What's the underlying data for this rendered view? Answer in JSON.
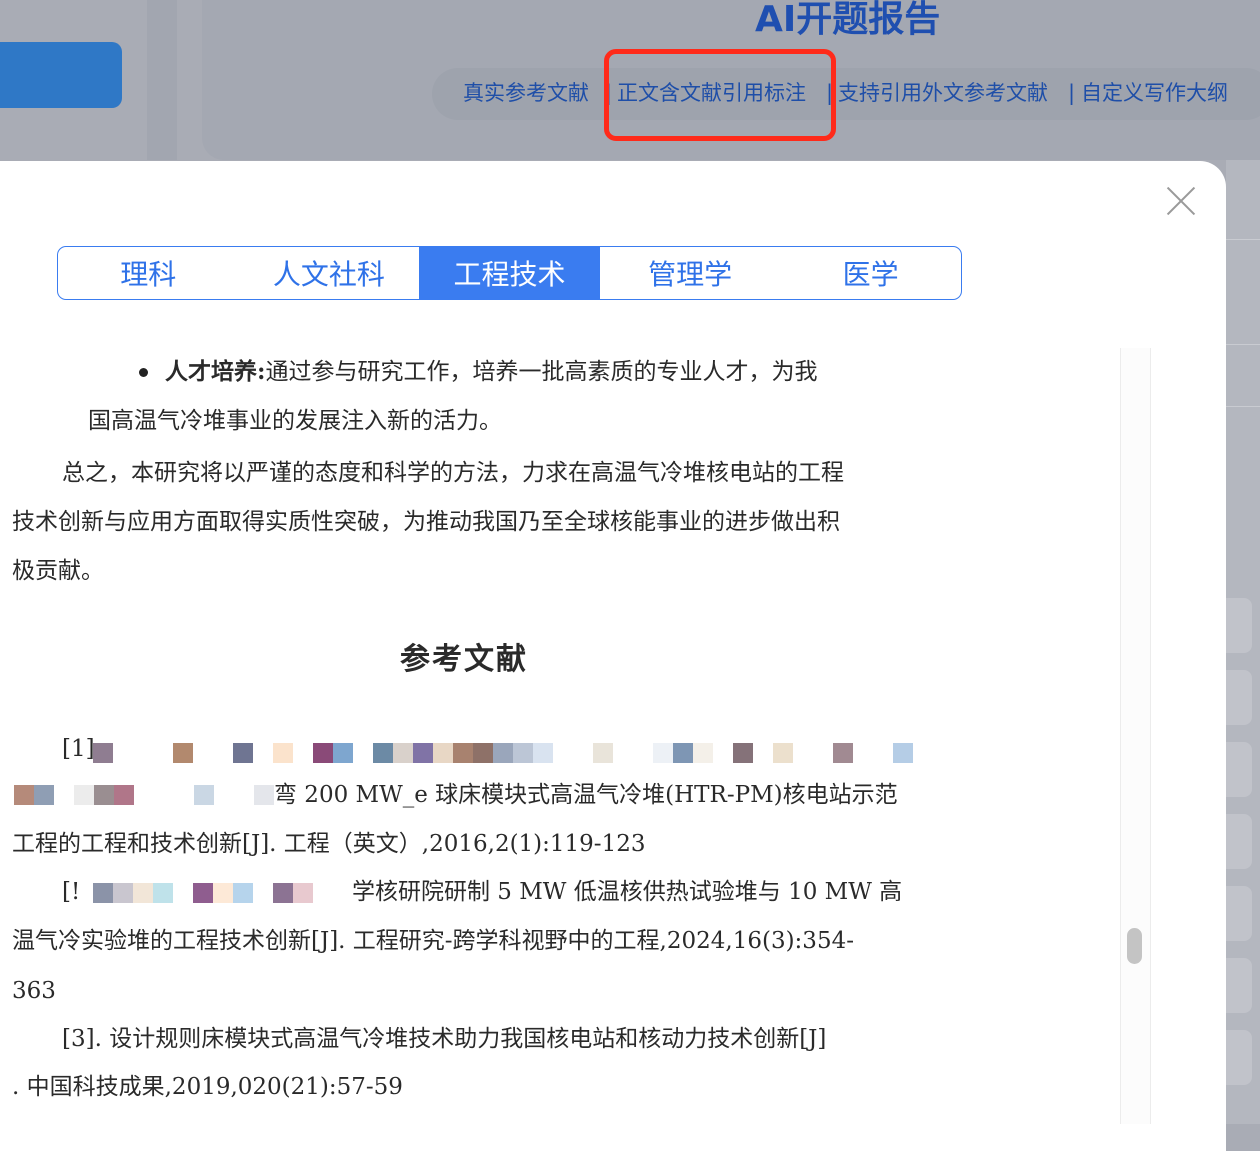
{
  "header": {
    "title": "AI开题报告",
    "features": [
      "真实参考文献",
      "正文含文献引用标注",
      "支持引用外文参考文献",
      "自定义写作大纲"
    ],
    "separator": "|"
  },
  "tabs": [
    {
      "label": "理科"
    },
    {
      "label": "人文社科"
    },
    {
      "label": "工程技术",
      "active": true
    },
    {
      "label": "管理学"
    },
    {
      "label": "医学"
    }
  ],
  "document": {
    "bullet_label": "人才培养:",
    "bullet_text": "通过参与研究工作，培养一批高素质的专业人才，为我",
    "bullet_cont": "国高温气冷堆事业的发展注入新的活力。",
    "para": [
      "总之，本研究将以严谨的态度和科学的方法，力求在高温气冷堆核电站的工程",
      "技术创新与应用方面取得实质性突破，为推动我国乃至全球核能事业的进步做出积",
      "极贡献。"
    ],
    "refs_title": "参考文献",
    "refs": {
      "r1_num": "[1]",
      "r1_b": "弯 200 MW_e 球床模块式高温气冷堆(HTR-PM)核电站示范",
      "r1_c": "工程的工程和技术创新[J].  工程（英文）,2016,2(1):119-123",
      "r2_a": "[!",
      "r2_a2": "学核研院研制 5 MW 低温核供热试验堆与 10 MW 高",
      "r2_b": "温气冷实验堆的工程技术创新[J].  工程研究-跨学科视野中的工程,2024,16(3):354-",
      "r2_c": "363",
      "r3_a": "[3].  设计规则床模块式高温气冷堆技术助力我国核电站和核动力技术创新[J]",
      "r3_b": ".  中国科技成果,2019,020(21):57-59"
    }
  },
  "colors": {
    "accent": "#3a7cf0",
    "highlight": "#ff2a1a",
    "header_text": "#1e4ea8"
  }
}
